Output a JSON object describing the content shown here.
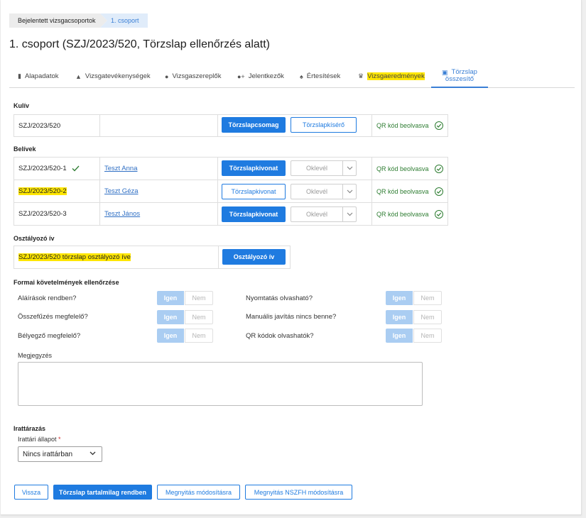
{
  "breadcrumb": {
    "parent": "Bejelentett vizsgacsoportok",
    "current": "1. csoport"
  },
  "page_title": "1. csoport (SZJ/2023/520, Törzslap ellenőrzés alatt)",
  "tabs": [
    {
      "label": "Alapadatok",
      "icon": "document-icon"
    },
    {
      "label": "Vizsgatevékenységek",
      "icon": "graduation-cap-icon"
    },
    {
      "label": "Vizsgaszereplők",
      "icon": "person-icon"
    },
    {
      "label": "Jelentkezők",
      "icon": "person-add-icon"
    },
    {
      "label": "Értesítések",
      "icon": "bell-icon"
    },
    {
      "label": "Vizsgaeredmények",
      "icon": "trophy-icon"
    },
    {
      "label_line1": "Törzslap",
      "label_line2": "összesítő",
      "icon": "clipboard-icon"
    }
  ],
  "kuliv": {
    "label": "Kulív",
    "code": "SZJ/2023/520",
    "btn_package": "Törzslapcsomag",
    "btn_cover": "Törzslapkísérő",
    "qr": "QR kód beolvasva"
  },
  "belivek": {
    "label": "Belívek",
    "rows": [
      {
        "code": "SZJ/2023/520-1",
        "name": "Teszt Anna",
        "btn": "Törzslapkivonat",
        "select": "Oklevél",
        "qr": "QR kód beolvasva"
      },
      {
        "code": "SZJ/2023/520-2",
        "name": "Teszt Géza",
        "btn": "Törzslapkivonat",
        "select": "Oklevél",
        "qr": "QR kód beolvasva"
      },
      {
        "code": "SZJ/2023/520-3",
        "name": "Teszt János",
        "btn": "Törzslapkivonat",
        "select": "Oklevél",
        "qr": "QR kód beolvasva"
      }
    ]
  },
  "osztalyozo": {
    "label": "Osztályozó ív",
    "text": "SZJ/2023/520 törzslap osztályozó íve",
    "btn": "Osztályozó ív"
  },
  "formai": {
    "label": "Formai követelmények ellenőrzése",
    "yes": "Igen",
    "no": "Nem",
    "left": [
      "Aláírások rendben?",
      "Összefűzés megfelelő?",
      "Bélyegző megfelelő?"
    ],
    "right": [
      "Nyomtatás olvasható?",
      "Manuális javítás nincs benne?",
      "QR kódok olvashatók?"
    ]
  },
  "note_label": "Megjegyzés",
  "archive": {
    "label": "Irattárazás",
    "field_label": "Irattári állapot",
    "required_mark": "*",
    "value": "Nincs irattárban"
  },
  "actions": {
    "back": "Vissza",
    "approve": "Törzslap tartalmilag rendben",
    "open_edit": "Megnyitás módosításra",
    "open_nszfh": "Megnyitás NSZFH módosításra"
  },
  "colors": {
    "primary": "#1f7be0",
    "success": "#2e7d32",
    "highlight": "#ffe600"
  }
}
